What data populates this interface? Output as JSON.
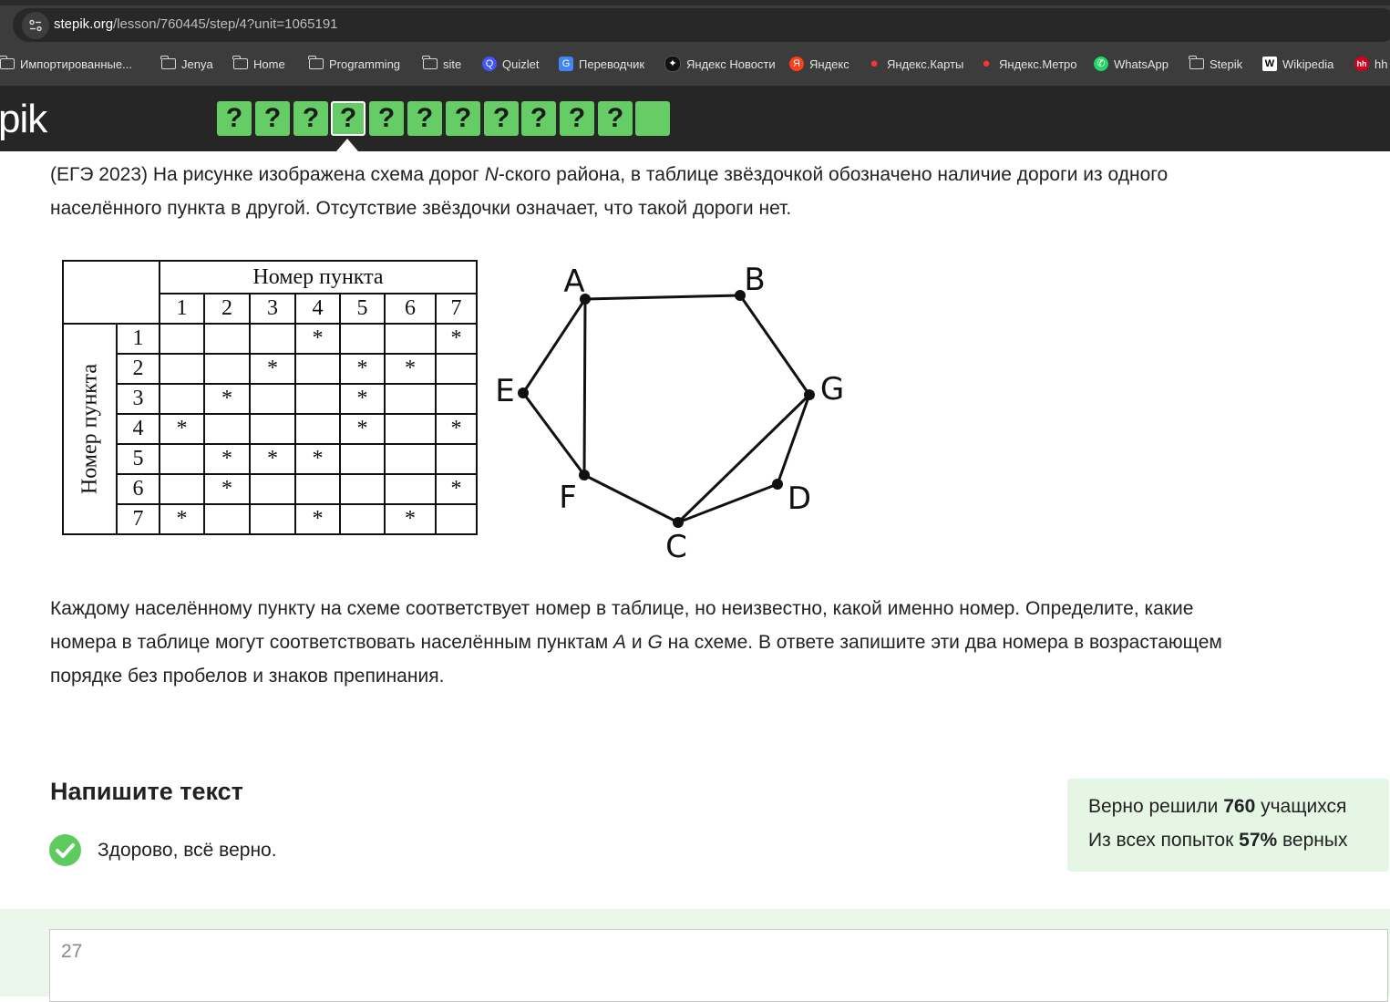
{
  "browser": {
    "url_host": "stepik.org",
    "url_path": "/lesson/760445/step/4?unit=1065191",
    "site_info_icon": "tune-icon",
    "bookmarks": [
      {
        "label": "Импортированные...",
        "icon": "folder-icon"
      },
      {
        "label": "Jenya",
        "icon": "folder-icon"
      },
      {
        "label": "Home",
        "icon": "folder-icon"
      },
      {
        "label": "Programming",
        "icon": "folder-icon"
      },
      {
        "label": "site",
        "icon": "folder-icon"
      },
      {
        "label": "Quizlet",
        "icon": "quizlet-icon"
      },
      {
        "label": "Переводчик",
        "icon": "translate-icon"
      },
      {
        "label": "Яндекс Новости",
        "icon": "yandex-news-icon"
      },
      {
        "label": "Яндекс",
        "icon": "yandex-icon"
      },
      {
        "label": "Яндекс.Карты",
        "icon": "map-pin-icon"
      },
      {
        "label": "Яндекс.Метро",
        "icon": "map-pin-icon"
      },
      {
        "label": "WhatsApp",
        "icon": "whatsapp-icon"
      },
      {
        "label": "Stepik",
        "icon": "folder-icon"
      },
      {
        "label": "Wikipedia",
        "icon": "wikipedia-icon"
      },
      {
        "label": "hh",
        "icon": "hh-icon"
      }
    ]
  },
  "header": {
    "logo": "pik",
    "steps": [
      "?",
      "?",
      "?",
      "?",
      "?",
      "?",
      "?",
      "?",
      "?",
      "?",
      "?",
      ""
    ],
    "current_step": 4,
    "step_color": "#66cc66"
  },
  "task": {
    "intro_1": "(ЕГЭ 2023) На рисунке изображена схема дорог ",
    "intro_n": "N",
    "intro_2": "-ского района, в таблице звёздочкой обозначено наличие дороги из одного",
    "intro_line2": "населённого пункта в другой. Отсутствие звёздочки означает, что такой дороги нет.",
    "q_line1": "Каждому населённому пункту на схеме соответствует номер в таблице, но неизвестно, какой именно номер. Определите, какие",
    "q_line2_a": "номера в таблице могут соответствовать населённым пунктам ",
    "q_a": "A",
    "q_and": " и ",
    "q_g": "G",
    "q_line2_b": " на схеме. В ответе запишите эти два номера в возрастающем",
    "q_line3": "порядке без пробелов и знаков препинания."
  },
  "table": {
    "col_header": "Номер пункта",
    "row_header": "Номер пункта",
    "numbers": [
      "1",
      "2",
      "3",
      "4",
      "5",
      "6",
      "7"
    ],
    "rows": [
      [
        "",
        "",
        "",
        "*",
        "",
        "",
        "*"
      ],
      [
        "",
        "",
        "*",
        "",
        "*",
        "*",
        ""
      ],
      [
        "",
        "*",
        "",
        "",
        "*",
        "",
        ""
      ],
      [
        "*",
        "",
        "",
        "",
        "*",
        "",
        "*"
      ],
      [
        "",
        "*",
        "*",
        "*",
        "",
        "",
        ""
      ],
      [
        "",
        "*",
        "",
        "",
        "",
        "",
        "*"
      ],
      [
        "*",
        "",
        "",
        "*",
        "",
        "*",
        ""
      ]
    ]
  },
  "graph": {
    "nodes": [
      "A",
      "B",
      "G",
      "D",
      "C",
      "F",
      "E"
    ],
    "edges": [
      [
        "A",
        "B"
      ],
      [
        "B",
        "G"
      ],
      [
        "G",
        "D"
      ],
      [
        "D",
        "C"
      ],
      [
        "C",
        "F"
      ],
      [
        "F",
        "E"
      ],
      [
        "E",
        "A"
      ],
      [
        "A",
        "F"
      ],
      [
        "G",
        "C"
      ]
    ]
  },
  "answer_section": {
    "title": "Напишите текст",
    "feedback": "Здорово, всё верно.",
    "answer_value": "27",
    "stats_prefix_1": "Верно решили ",
    "stats_count": "760",
    "stats_suffix_1": " учащихся",
    "stats_prefix_2": "Из всех попыток ",
    "stats_percent": "57%",
    "stats_suffix_2": " верных"
  }
}
